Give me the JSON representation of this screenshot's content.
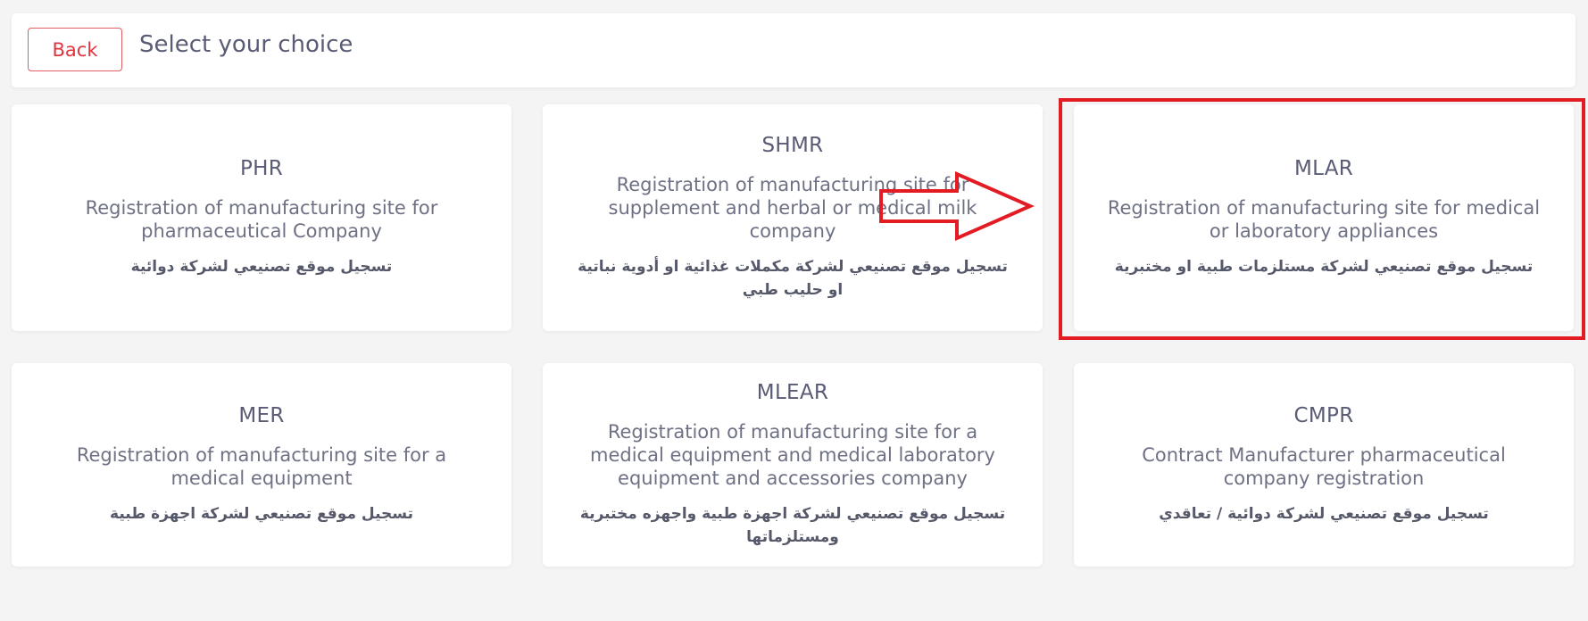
{
  "header": {
    "back_label": "Back",
    "title": "Select your choice"
  },
  "cards": [
    {
      "code": "PHR",
      "description": "Registration of manufacturing site for pharmaceutical Company",
      "arabic": "تسجيل موقع تصنيعي لشركة دوائية"
    },
    {
      "code": "SHMR",
      "description": "Registration of manufacturing site for supplement and herbal or medical milk company",
      "arabic": "تسجيل موقع تصنيعي لشركة مكملات غذائية او أدوية نباتية او حليب طبي"
    },
    {
      "code": "MLAR",
      "description": "Registration of manufacturing site for medical or laboratory appliances",
      "arabic": "تسجيل موقع تصنيعي لشركة مستلزمات طبية او مختبرية"
    },
    {
      "code": "MER",
      "description": "Registration of manufacturing site for a medical equipment",
      "arabic": "تسجيل موقع تصنيعي لشركة اجهزة طبية"
    },
    {
      "code": "MLEAR",
      "description": "Registration of manufacturing site for a medical equipment and medical laboratory equipment and accessories company",
      "arabic": "تسجيل موقع تصنيعي لشركة اجهزة طبية واجهزه مختبرية ومستلزماتها"
    },
    {
      "code": "CMPR",
      "description": "Contract Manufacturer pharmaceutical company registration",
      "arabic": "تسجيل موقع تصنيعي لشركة دوائية / تعاقدي"
    }
  ],
  "annotation": {
    "color": "#e31b23",
    "arrow_icon": "right-arrow-icon",
    "highlight_target": "MLAR"
  }
}
